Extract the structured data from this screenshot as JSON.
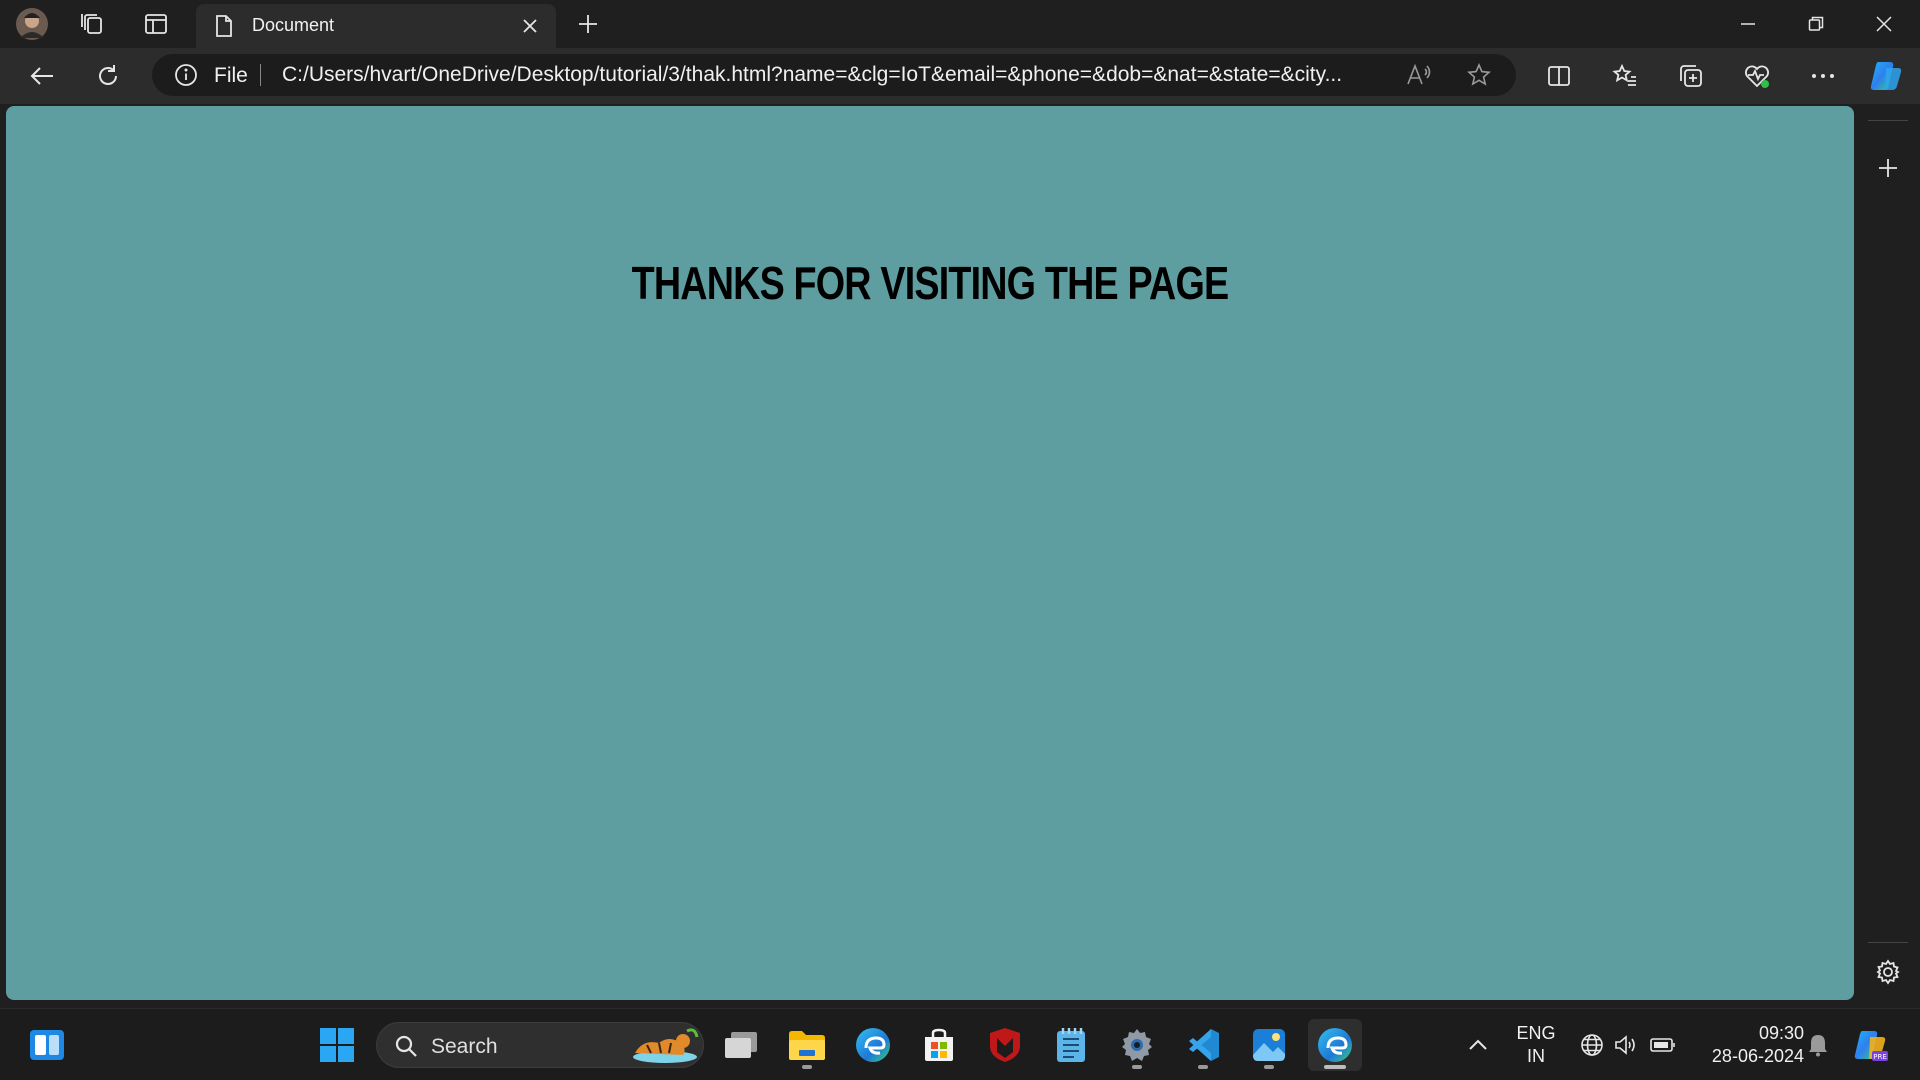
{
  "browser": {
    "tab_title": "Document",
    "address_scheme": "File",
    "address_url": "C:/Users/hvart/OneDrive/Desktop/tutorial/3/thak.html?name=&clg=IoT&email=&phone=&dob=&nat=&state=&city..."
  },
  "page": {
    "heading": "THANKS FOR VISITING THE PAGE",
    "background_color": "#5f9ea0"
  },
  "taskbar": {
    "search_placeholder": "Search",
    "language_top": "ENG",
    "language_bottom": "IN",
    "time": "09:30",
    "date": "28-06-2024"
  },
  "icons": [
    "profile-avatar-icon",
    "workspaces-icon",
    "tab-actions-icon",
    "page-icon",
    "close-icon",
    "new-tab-icon",
    "minimize-icon",
    "restore-icon",
    "back-icon",
    "refresh-icon",
    "info-icon",
    "read-aloud-icon",
    "favorite-star-icon",
    "split-screen-icon",
    "favorites-icon",
    "collections-icon",
    "browser-essentials-icon",
    "more-icon",
    "copilot-icon",
    "add-icon",
    "settings-icon",
    "widgets-icon",
    "windows-start-icon",
    "search-icon",
    "task-view-icon",
    "file-explorer-icon",
    "edge-icon",
    "store-icon",
    "mcafee-icon",
    "notepad-icon",
    "settings-app-icon",
    "vscode-icon",
    "photos-icon",
    "chevron-up-icon",
    "network-icon",
    "volume-icon",
    "battery-icon",
    "notification-bell-icon"
  ]
}
